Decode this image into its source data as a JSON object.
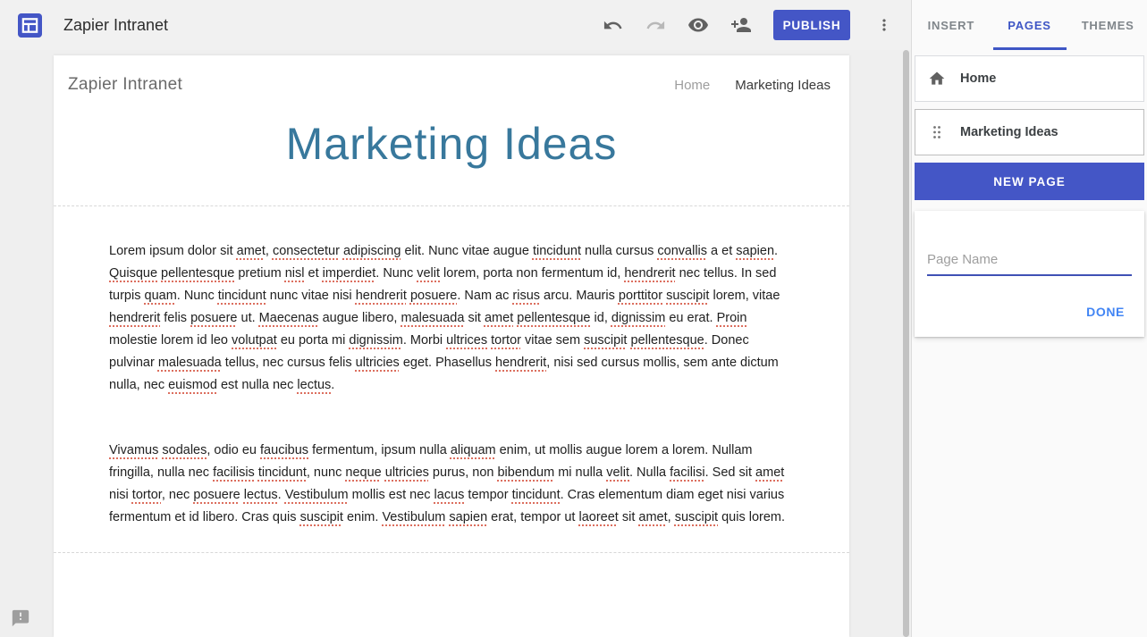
{
  "topbar": {
    "site_name": "Zapier Intranet",
    "publish_label": "PUBLISH"
  },
  "panel": {
    "tabs": [
      {
        "label": "INSERT",
        "active": false
      },
      {
        "label": "PAGES",
        "active": true
      },
      {
        "label": "THEMES",
        "active": false
      }
    ],
    "pages": [
      {
        "label": "Home",
        "icon": "home-icon",
        "selected": false
      },
      {
        "label": "Marketing Ideas",
        "icon": "drag-handle-icon",
        "selected": true
      }
    ],
    "new_page_label": "NEW PAGE",
    "page_name_placeholder": "Page Name",
    "page_name_value": "",
    "done_label": "DONE"
  },
  "site": {
    "header_title": "Zapier Intranet",
    "nav": [
      {
        "label": "Home",
        "current": false
      },
      {
        "label": "Marketing Ideas",
        "current": true
      }
    ],
    "page_title": "Marketing Ideas"
  },
  "content": {
    "paragraphs": [
      [
        {
          "t": "Lorem ipsum dolor sit "
        },
        {
          "t": "amet",
          "m": true
        },
        {
          "t": ", "
        },
        {
          "t": "consectetur",
          "m": true
        },
        {
          "t": " "
        },
        {
          "t": "adipiscing",
          "m": true
        },
        {
          "t": " elit. Nunc vitae augue "
        },
        {
          "t": "tincidunt",
          "m": true
        },
        {
          "t": " nulla cursus "
        },
        {
          "t": "convallis",
          "m": true
        },
        {
          "t": " a et "
        },
        {
          "t": "sapien",
          "m": true
        },
        {
          "t": ". "
        },
        {
          "t": "Quisque",
          "m": true
        },
        {
          "t": " "
        },
        {
          "t": "pellentesque",
          "m": true
        },
        {
          "t": " pretium "
        },
        {
          "t": "nisl",
          "m": true
        },
        {
          "t": " et "
        },
        {
          "t": "imperdiet",
          "m": true
        },
        {
          "t": ". Nunc "
        },
        {
          "t": "velit",
          "m": true
        },
        {
          "t": " lorem, porta non fermentum id, "
        },
        {
          "t": "hendrerit",
          "m": true
        },
        {
          "t": " nec tellus. In sed turpis "
        },
        {
          "t": "quam",
          "m": true
        },
        {
          "t": ". Nunc "
        },
        {
          "t": "tincidunt",
          "m": true
        },
        {
          "t": " nunc vitae nisi "
        },
        {
          "t": "hendrerit",
          "m": true
        },
        {
          "t": " "
        },
        {
          "t": "posuere",
          "m": true
        },
        {
          "t": ". Nam ac "
        },
        {
          "t": "risus",
          "m": true
        },
        {
          "t": " arcu. Mauris "
        },
        {
          "t": "porttitor",
          "m": true
        },
        {
          "t": " "
        },
        {
          "t": "suscipit",
          "m": true
        },
        {
          "t": " lorem, vitae "
        },
        {
          "t": "hendrerit",
          "m": true
        },
        {
          "t": " felis "
        },
        {
          "t": "posuere",
          "m": true
        },
        {
          "t": " ut. "
        },
        {
          "t": "Maecenas",
          "m": true
        },
        {
          "t": " augue libero, "
        },
        {
          "t": "malesuada",
          "m": true
        },
        {
          "t": " sit "
        },
        {
          "t": "amet",
          "m": true
        },
        {
          "t": " "
        },
        {
          "t": "pellentesque",
          "m": true
        },
        {
          "t": " id, "
        },
        {
          "t": "dignissim",
          "m": true
        },
        {
          "t": " eu erat. "
        },
        {
          "t": "Proin",
          "m": true
        },
        {
          "t": " molestie lorem id leo "
        },
        {
          "t": "volutpat",
          "m": true
        },
        {
          "t": " eu porta mi "
        },
        {
          "t": "dignissim",
          "m": true
        },
        {
          "t": ". Morbi "
        },
        {
          "t": "ultrices",
          "m": true
        },
        {
          "t": " "
        },
        {
          "t": "tortor",
          "m": true
        },
        {
          "t": " vitae sem "
        },
        {
          "t": "suscipit",
          "m": true
        },
        {
          "t": " "
        },
        {
          "t": "pellentesque",
          "m": true
        },
        {
          "t": ". Donec pulvinar "
        },
        {
          "t": "malesuada",
          "m": true
        },
        {
          "t": " tellus, nec cursus felis "
        },
        {
          "t": "ultricies",
          "m": true
        },
        {
          "t": " eget. Phasellus "
        },
        {
          "t": "hendrerit",
          "m": true
        },
        {
          "t": ", nisi sed cursus mollis, sem ante dictum nulla, nec "
        },
        {
          "t": "euismod",
          "m": true
        },
        {
          "t": " est nulla nec "
        },
        {
          "t": "lectus",
          "m": true
        },
        {
          "t": "."
        }
      ],
      [
        {
          "t": "Vivamus",
          "m": true
        },
        {
          "t": " "
        },
        {
          "t": "sodales",
          "m": true
        },
        {
          "t": ", odio eu "
        },
        {
          "t": "faucibus",
          "m": true
        },
        {
          "t": " fermentum, ipsum nulla "
        },
        {
          "t": "aliquam",
          "m": true
        },
        {
          "t": " enim, ut mollis augue lorem a lorem. Nullam fringilla, nulla nec "
        },
        {
          "t": "facilisis",
          "m": true
        },
        {
          "t": " "
        },
        {
          "t": "tincidunt",
          "m": true
        },
        {
          "t": ", nunc "
        },
        {
          "t": "neque",
          "m": true
        },
        {
          "t": " "
        },
        {
          "t": "ultricies",
          "m": true
        },
        {
          "t": " purus, non "
        },
        {
          "t": "bibendum",
          "m": true
        },
        {
          "t": " mi nulla "
        },
        {
          "t": "velit",
          "m": true
        },
        {
          "t": ". Nulla "
        },
        {
          "t": "facilisi",
          "m": true
        },
        {
          "t": ". Sed sit "
        },
        {
          "t": "amet",
          "m": true
        },
        {
          "t": " nisi "
        },
        {
          "t": "tortor",
          "m": true
        },
        {
          "t": ", nec "
        },
        {
          "t": "posuere",
          "m": true
        },
        {
          "t": " "
        },
        {
          "t": "lectus",
          "m": true
        },
        {
          "t": ". "
        },
        {
          "t": "Vestibulum",
          "m": true
        },
        {
          "t": " mollis est nec "
        },
        {
          "t": "lacus",
          "m": true
        },
        {
          "t": " tempor "
        },
        {
          "t": "tincidunt",
          "m": true
        },
        {
          "t": ". Cras elementum diam eget nisi varius fermentum et id libero. Cras quis "
        },
        {
          "t": "suscipit",
          "m": true
        },
        {
          "t": " enim. "
        },
        {
          "t": "Vestibulum",
          "m": true
        },
        {
          "t": " "
        },
        {
          "t": "sapien",
          "m": true
        },
        {
          "t": " erat, tempor ut "
        },
        {
          "t": "laoreet",
          "m": true
        },
        {
          "t": " sit "
        },
        {
          "t": "amet",
          "m": true
        },
        {
          "t": ", "
        },
        {
          "t": "suscipit",
          "m": true
        },
        {
          "t": " quis lorem."
        }
      ]
    ]
  },
  "colors": {
    "accent_indigo": "#4456c6",
    "tab_active_blue": "#3e56c5",
    "done_blue": "#4285f4",
    "title_teal": "#38789c",
    "spellcheck_red": "#dc6e5e"
  }
}
